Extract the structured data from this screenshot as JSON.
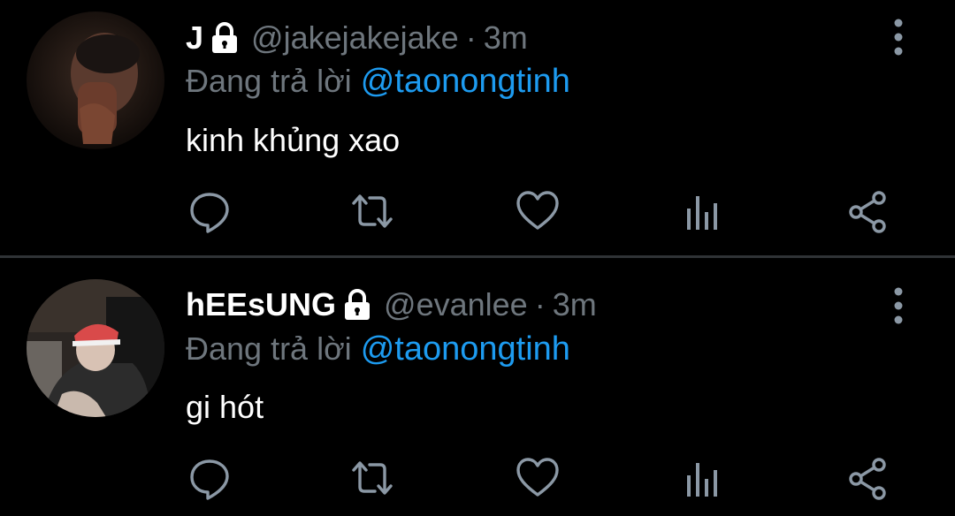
{
  "tweets": [
    {
      "display_name": "J",
      "handle": "@jakejakejake",
      "separator": "·",
      "time": "3m",
      "reply_prefix": "Đang trả lời",
      "reply_to": "@taonongtinh",
      "text": "kinh khủng xao",
      "protected_icon": "lock-icon"
    },
    {
      "display_name": "hEEsUNG",
      "handle": "@evanlee",
      "separator": "·",
      "time": "3m",
      "reply_prefix": "Đang trả lời",
      "reply_to": "@taonongtinh",
      "text": "gi hót",
      "protected_icon": "lock-icon"
    }
  ],
  "action_icons": [
    "reply-icon",
    "retweet-icon",
    "like-icon",
    "analytics-icon",
    "share-icon"
  ],
  "colors": {
    "background": "#000000",
    "text_primary": "#ffffff",
    "text_secondary": "#6e767d",
    "mention": "#1d9bf0",
    "divider": "#2f3336",
    "icon": "#8b98a5"
  }
}
